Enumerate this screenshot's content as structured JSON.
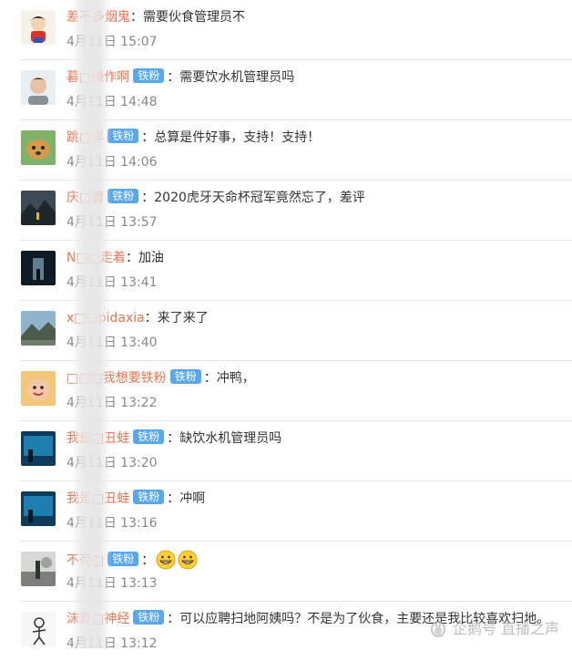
{
  "comments": [
    {
      "user": "差不多烟鬼",
      "badge": "",
      "text": "需要伙食管理员不",
      "time": "4月11日 15:07",
      "avatar": "cartoon-avatar"
    },
    {
      "user": "暮□操作啊",
      "badge": "铁粉",
      "text": "需要饮水机管理员吗",
      "time": "4月11日 14:48",
      "avatar": "portrait-avatar"
    },
    {
      "user": "跳□洋",
      "badge": "铁粉",
      "text": "总算是件好事，支持！支持！",
      "time": "4月11日 14:06",
      "avatar": "puppy-avatar"
    },
    {
      "user": "庆□曹",
      "badge": "铁粉",
      "text": "2020虎牙天命杯冠军竟然忘了，差评",
      "time": "4月11日 13:57",
      "avatar": "landscape-avatar"
    },
    {
      "user": "N□□走着",
      "badge": "",
      "text": "加油",
      "time": "4月11日 13:41",
      "avatar": "corridor-avatar"
    },
    {
      "user": "x□□pidaxia",
      "badge": "",
      "text": "来了来了",
      "time": "4月11日 13:40",
      "avatar": "mountain-avatar"
    },
    {
      "user": "□□□我想要铁粉",
      "badge": "铁粉",
      "text": "冲鸭，",
      "time": "4月11日 13:22",
      "avatar": "child-avatar"
    },
    {
      "user": "我是□丑蛙",
      "badge": "铁粉",
      "text": "缺饮水机管理员吗",
      "time": "4月11日 13:20",
      "avatar": "aquarium-avatar"
    },
    {
      "user": "我是□丑蛙",
      "badge": "铁粉",
      "text": "冲啊",
      "time": "4月11日 13:16",
      "avatar": "aquarium-avatar"
    },
    {
      "user": "不苟□",
      "badge": "铁粉",
      "text": "",
      "time": "4月11日 13:13",
      "avatar": "street-avatar",
      "emoji_count": 2
    },
    {
      "user": "沫夏□神经",
      "badge": "铁粉",
      "text": "可以应聘扫地阿姨吗？不是为了伙食，主要还是我比较喜欢扫地。",
      "time": "4月11日 13:12",
      "avatar": "sketch-avatar"
    }
  ],
  "colon": "：",
  "watermark": "企鹅号 直播之声",
  "colors": {
    "username": "#eb7350",
    "badge_bg": "#58a8f0",
    "time": "#888888",
    "divider": "#e6e6e6"
  }
}
